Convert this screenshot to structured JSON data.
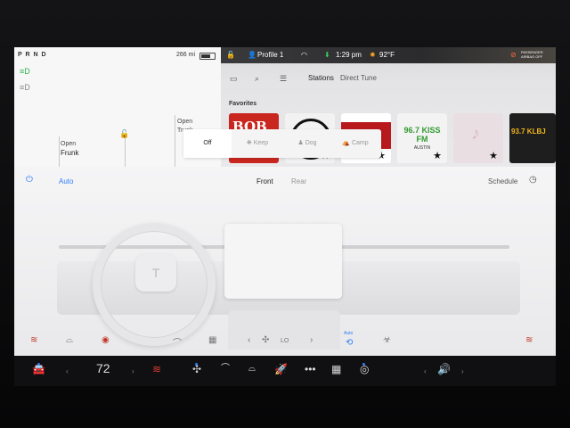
{
  "car": {
    "gear": "P R N D",
    "range": "266 mi",
    "frunk_line1": "Open",
    "frunk_line2": "Frunk",
    "trunk_line1": "Open",
    "trunk_line2": "Trunk"
  },
  "status": {
    "profile": "Profile 1",
    "time": "1:29 pm",
    "temperature": "92°F",
    "airbag_line1": "PASSENGER",
    "airbag_line2": "AIRBAG OFF"
  },
  "media": {
    "tabs": [
      "Stations",
      "Direct Tune"
    ],
    "favorites_label": "Favorites",
    "stations": [
      {
        "name": "BOB",
        "color": "#c9261f"
      },
      {
        "name": "",
        "color": "#f2f2f2"
      },
      {
        "name": "",
        "color": "#b8191d"
      },
      {
        "name": "96.7 KISS FM",
        "sub": "AUSTIN",
        "color": "#f3f3f3"
      },
      {
        "name": "♪",
        "color": "#e9dfe2"
      },
      {
        "name": "93.7 KLBJ",
        "color": "#1e1e1e"
      }
    ]
  },
  "cabin_modes": [
    "Off",
    "Keep",
    "Dog",
    "Camp"
  ],
  "climate": {
    "mode": "Auto",
    "tab_front": "Front",
    "tab_rear": "Rear",
    "schedule": "Schedule",
    "fan": "LO",
    "ac_label": "Auto"
  },
  "dock": {
    "temperature": "72"
  },
  "colors": {
    "accent": "#2f7cf6",
    "alert": "#e23b2e"
  }
}
